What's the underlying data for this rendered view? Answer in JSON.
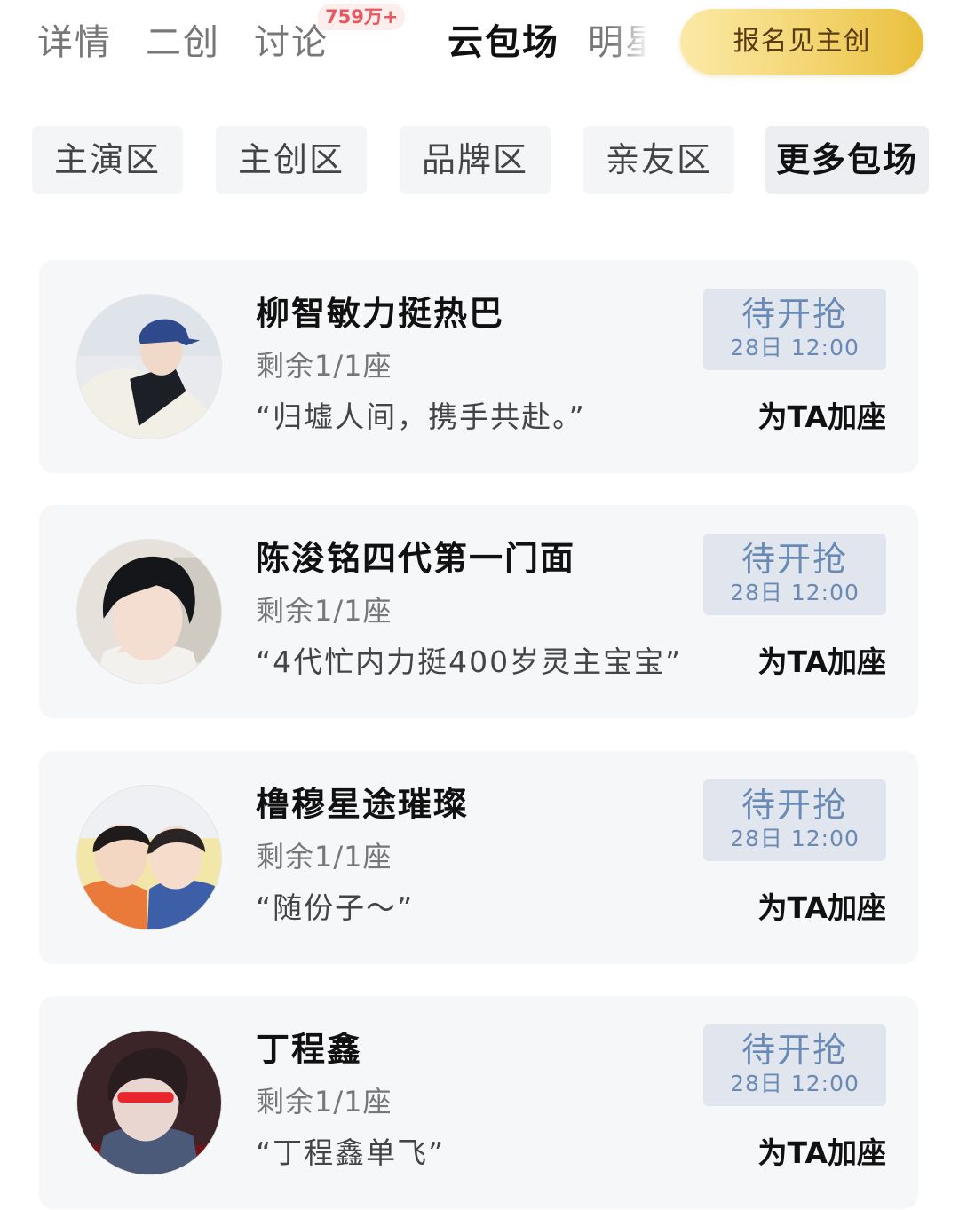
{
  "tabs": [
    {
      "label": "详情",
      "active": false
    },
    {
      "label": "二创",
      "active": false
    },
    {
      "label": "讨论",
      "active": false
    },
    {
      "label": "云包场",
      "active": true
    },
    {
      "label": "明星",
      "active": false
    }
  ],
  "discussion_badge": "759万+",
  "signup_button": "报名见主创",
  "categories": [
    {
      "label": "主演区",
      "active": false
    },
    {
      "label": "主创区",
      "active": false
    },
    {
      "label": "品牌区",
      "active": false
    },
    {
      "label": "亲友区",
      "active": false
    },
    {
      "label": "更多包场",
      "active": true
    }
  ],
  "cards": [
    {
      "name": "柳智敏力挺热巴",
      "seats": "剩余1/1座",
      "quote": "“归墟人间，携手共赴。”",
      "grab_label": "待开抢",
      "grab_time": "28日 12:00",
      "add_seat": "为TA加座"
    },
    {
      "name": "陈浚铭四代第一门面",
      "seats": "剩余1/1座",
      "quote": "“4代忙内力挺400岁灵主宝宝”",
      "grab_label": "待开抢",
      "grab_time": "28日 12:00",
      "add_seat": "为TA加座"
    },
    {
      "name": "橹穆星途璀璨",
      "seats": "剩余1/1座",
      "quote": "“随份子～”",
      "grab_label": "待开抢",
      "grab_time": "28日 12:00",
      "add_seat": "为TA加座"
    },
    {
      "name": "丁程鑫",
      "seats": "剩余1/1座",
      "quote": "“丁程鑫单飞”",
      "grab_label": "待开抢",
      "grab_time": "28日 12:00",
      "add_seat": "为TA加座"
    }
  ],
  "colors": {
    "badge_text": "#e8585f",
    "signup_gradient_start": "#fbe9a6",
    "signup_gradient_end": "#e9bf3c",
    "grab_button_bg": "#e1e6ee",
    "grab_button_text": "#6a8ab6",
    "card_bg": "#f6f7f9"
  }
}
